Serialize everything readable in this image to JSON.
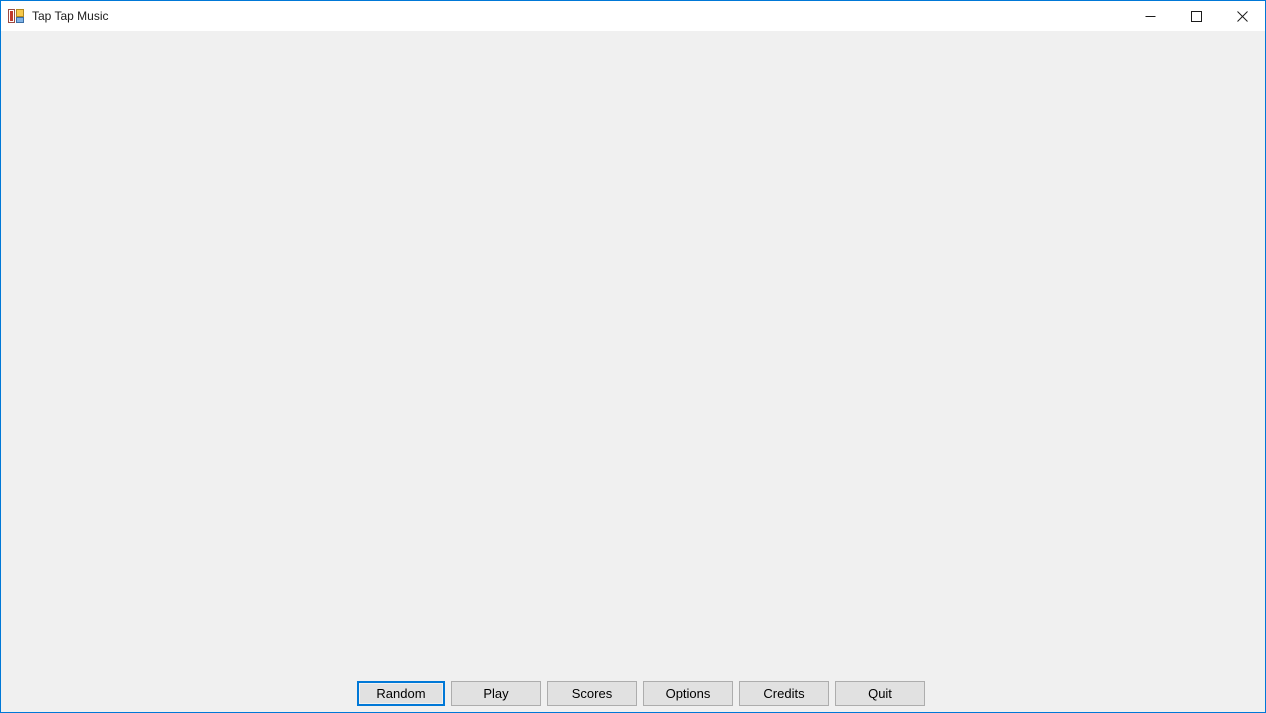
{
  "window": {
    "title": "Tap Tap Music",
    "icon": "app-window-icon",
    "accent_color": "#0078d7",
    "titlebar_background": "#ffffff",
    "client_background": "#f0f0f0",
    "controls": [
      {
        "name": "minimize",
        "label": "Minimize",
        "glyph": "minimize-icon"
      },
      {
        "name": "maximize",
        "label": "Maximize",
        "glyph": "maximize-icon"
      },
      {
        "name": "close",
        "label": "Close",
        "glyph": "close-icon"
      }
    ]
  },
  "main": {
    "content": "",
    "buttons": [
      {
        "label": "Random",
        "focused": true,
        "name": "random-button"
      },
      {
        "label": "Play",
        "focused": false,
        "name": "play-button"
      },
      {
        "label": "Scores",
        "focused": false,
        "name": "scores-button"
      },
      {
        "label": "Options",
        "focused": false,
        "name": "options-button"
      },
      {
        "label": "Credits",
        "focused": false,
        "name": "credits-button"
      },
      {
        "label": "Quit",
        "focused": false,
        "name": "quit-button"
      }
    ]
  }
}
